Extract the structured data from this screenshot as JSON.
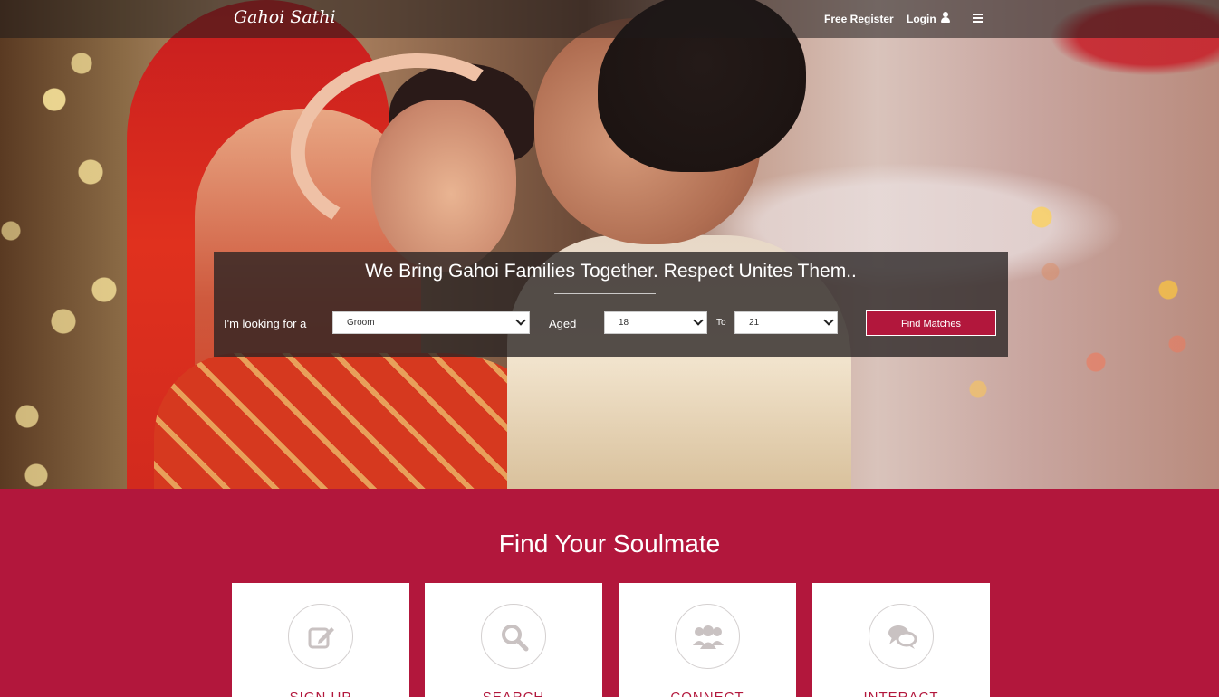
{
  "header": {
    "brand": "Gahoi Sathi",
    "nav": {
      "register": "Free Register",
      "login": "Login"
    },
    "icons": [
      "user-icon",
      "menu-icon"
    ]
  },
  "search": {
    "title": "We Bring Gahoi Families Together. Respect Unites Them..",
    "looking_label": "I'm looking for a",
    "looking_value": "Groom",
    "aged_label": "Aged",
    "age_from": "18",
    "to_label": "To",
    "age_to": "21",
    "button": "Find Matches"
  },
  "features": {
    "title": "Find Your Soulmate",
    "cards": [
      {
        "label": "SIGN UP",
        "icon": "edit-icon"
      },
      {
        "label": "SEARCH",
        "icon": "search-icon"
      },
      {
        "label": "CONNECT",
        "icon": "users-icon"
      },
      {
        "label": "INTERACT",
        "icon": "chat-icon"
      }
    ]
  },
  "colors": {
    "brand": "#b2173c",
    "card_icon": "#c9c2c2"
  }
}
